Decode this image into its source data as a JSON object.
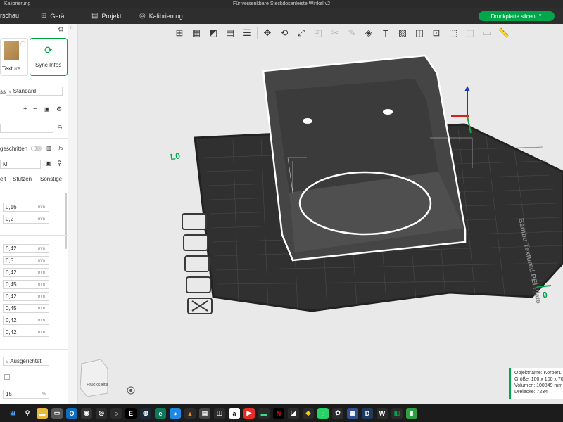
{
  "titlebar": {
    "app": "Kalibrierung",
    "document": "Für versenkbare Steckdosenleiste Winkel v2"
  },
  "menu": {
    "tabs": [
      {
        "label": "rschau"
      },
      {
        "label": "Gerät"
      },
      {
        "label": "Projekt"
      },
      {
        "label": "Kalibrierung"
      }
    ],
    "slice_button": "Druckplatte slicen"
  },
  "sidebar": {
    "texture_label": "Texture...",
    "sync_label": "Sync Infos",
    "filament_prefix": "ss",
    "filament_value": "Standard",
    "process_toggle_label": "geschritten",
    "preset_value": "M",
    "tabs": [
      "eit",
      "Stützen",
      "Sonstige"
    ],
    "quality_values": [
      "0,16",
      "0,2"
    ],
    "width_values": [
      "0,42",
      "0,5",
      "0,42",
      "0,45",
      "0,42",
      "0,45",
      "0,42",
      "0,42"
    ],
    "unit": "mm",
    "align_value": "Ausgerichtet",
    "percent_value": "15",
    "percent_unit": "%"
  },
  "viewport": {
    "plate_text": "Bambu Textured PEI Plate",
    "plate_label_lo": "L0",
    "plate_number": "0",
    "navcube_label": "Rückseite",
    "info": {
      "name": "Objektname: Körper1",
      "size": "Größe: 100 x 100 x 70",
      "volume": "Volumen: 100849 mm",
      "triangles": "Dreiecke: 7234"
    }
  },
  "colors": {
    "accent": "#00a74a",
    "plate": "#3a3a3a",
    "model": "#4a4a4a"
  }
}
